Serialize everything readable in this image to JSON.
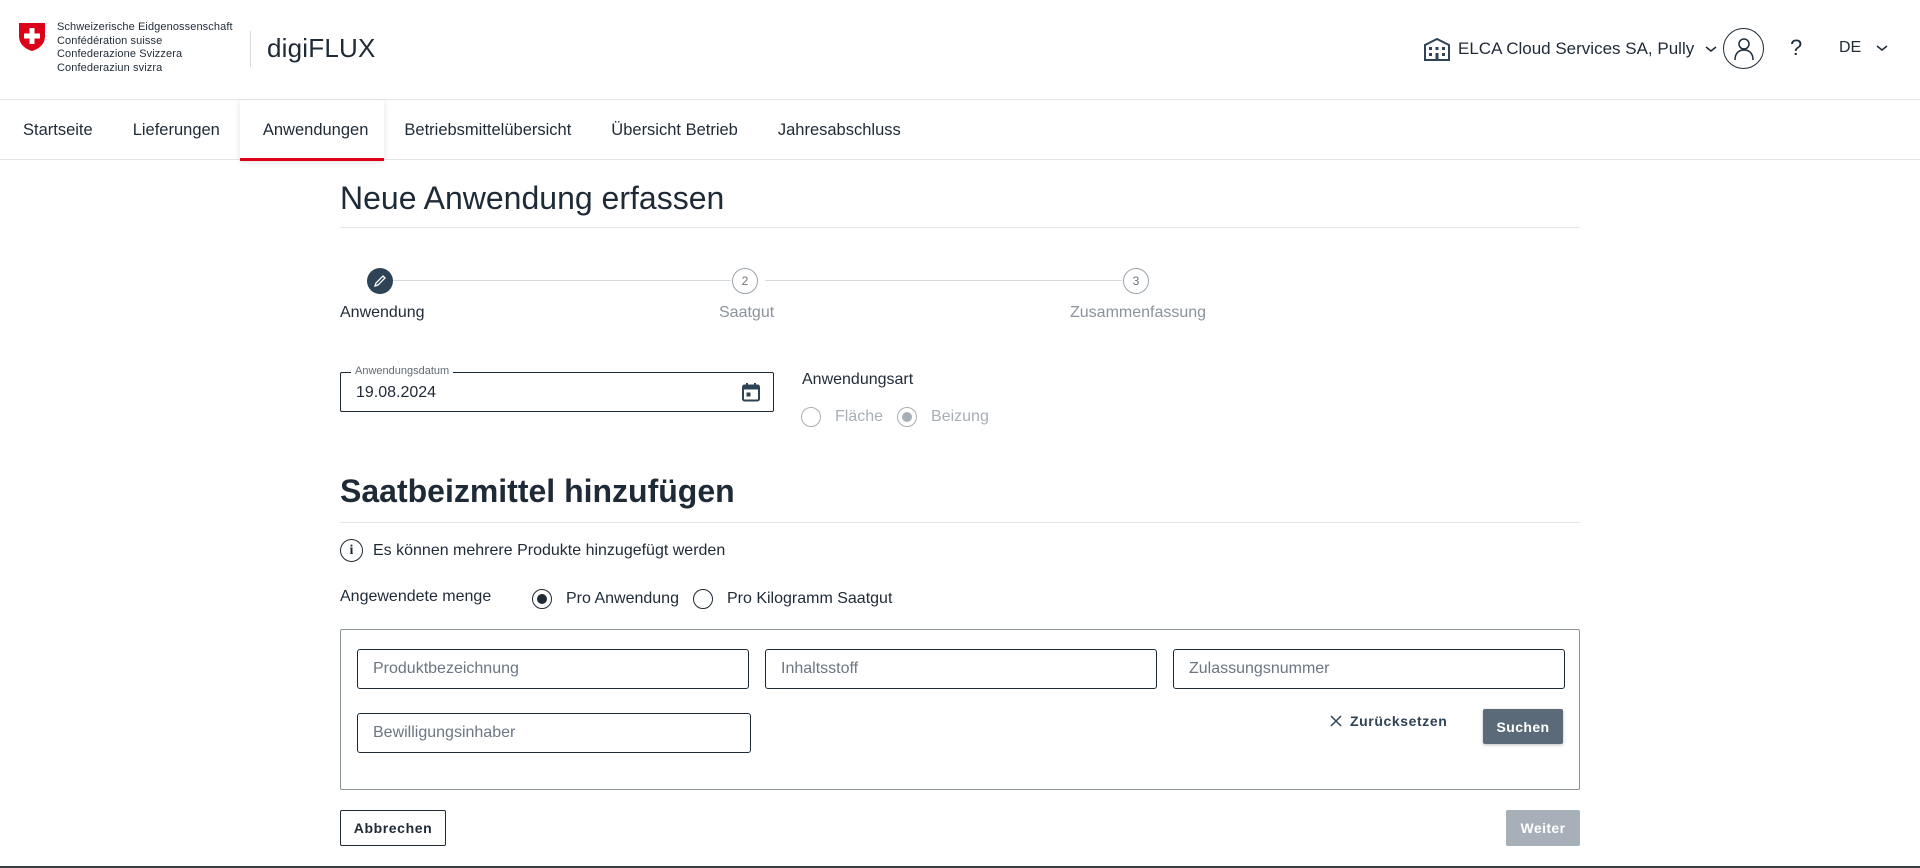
{
  "header": {
    "confederation": [
      "Schweizerische Eidgenossenschaft",
      "Confédération suisse",
      "Confederazione Svizzera",
      "Confederaziun svizra"
    ],
    "app_name": "digiFLUX",
    "organization": "ELCA Cloud Services SA, Pully",
    "help_label": "?",
    "language": "DE"
  },
  "nav": {
    "items": [
      {
        "label": "Startseite"
      },
      {
        "label": "Lieferungen"
      },
      {
        "label": "Anwendungen",
        "active": true
      },
      {
        "label": "Betriebsmittelübersicht"
      },
      {
        "label": "Übersicht Betrieb"
      },
      {
        "label": "Jahresabschluss"
      }
    ]
  },
  "page": {
    "title": "Neue Anwendung erfassen",
    "steps": [
      {
        "number": "1",
        "label": "Anwendung",
        "state": "current"
      },
      {
        "number": "2",
        "label": "Saatgut",
        "state": "todo"
      },
      {
        "number": "3",
        "label": "Zusammenfassung",
        "state": "todo"
      }
    ],
    "date_field": {
      "label": "Anwendungsdatum",
      "value": "19.08.2024"
    },
    "anwendungsart": {
      "label": "Anwendungsart",
      "options": [
        {
          "label": "Fläche",
          "selected": false
        },
        {
          "label": "Beizung",
          "selected": true
        }
      ]
    }
  },
  "section": {
    "title": "Saatbeizmittel hinzufügen",
    "info": "Es können mehrere Produkte hinzugefügt werden",
    "menge": {
      "label": "Angewendete menge",
      "options": [
        {
          "label": "Pro Anwendung",
          "selected": true
        },
        {
          "label": "Pro Kilogramm Saatgut",
          "selected": false
        }
      ]
    },
    "search": {
      "produkt_placeholder": "Produktbezeichnung",
      "inhaltsstoff_placeholder": "Inhaltsstoff",
      "zulassung_placeholder": "Zulassungsnummer",
      "bewilligung_placeholder": "Bewilligungsinhaber",
      "reset_label": "Zurücksetzen",
      "search_label": "Suchen"
    }
  },
  "footer": {
    "cancel_label": "Abbrechen",
    "next_label": "Weiter"
  },
  "colors": {
    "accent_red": "#dc0018",
    "primary_dark": "#1f2a37",
    "button_grey": "#5b6a78",
    "disabled_grey": "#a7b0b9"
  },
  "icons": [
    "swiss-coat-of-arms-icon",
    "building-icon",
    "chevron-down-icon",
    "user-icon",
    "calendar-icon",
    "pencil-icon",
    "info-icon",
    "close-icon"
  ]
}
